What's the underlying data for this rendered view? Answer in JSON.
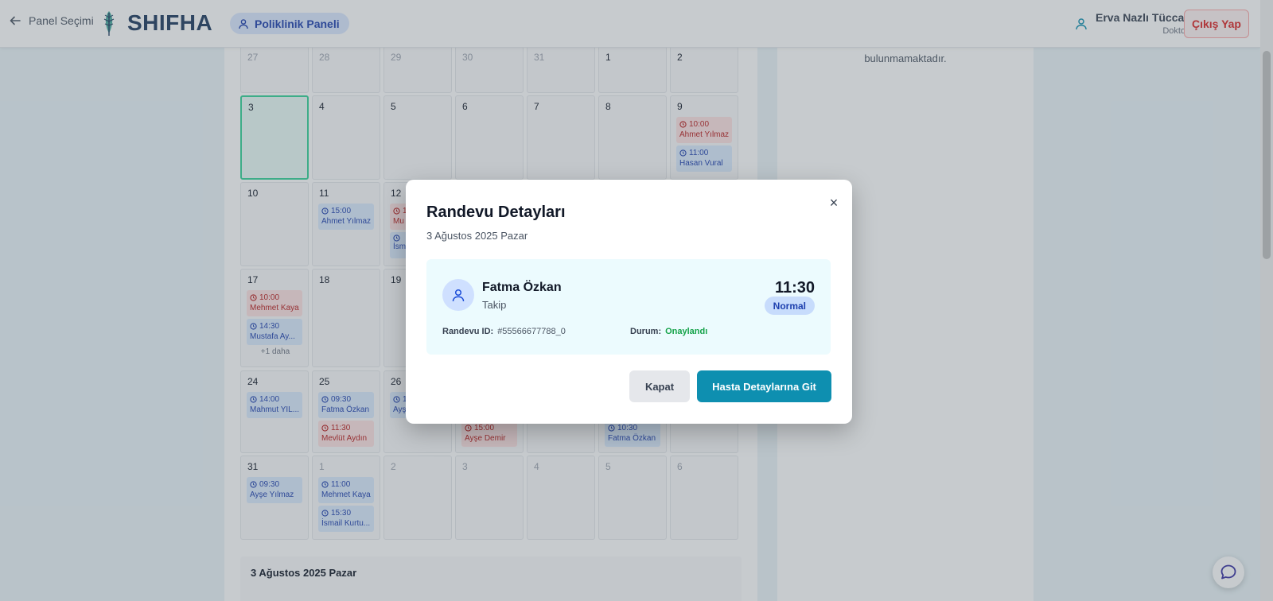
{
  "header": {
    "back_label": "Panel Seçimi",
    "logo_text": "SHIFHA",
    "panel_label": "Poliklinik Paneli",
    "user_name": "Erva Nazlı Tüccar",
    "user_role": "Doktor",
    "logout_label": "Çıkış Yap"
  },
  "side_panel": {
    "message_partial": "bulunmamaktadır."
  },
  "calendar": {
    "weeks": [
      {
        "days": [
          {
            "num": "27",
            "muted": true,
            "appts": []
          },
          {
            "num": "28",
            "muted": true,
            "appts": []
          },
          {
            "num": "29",
            "muted": true,
            "appts": []
          },
          {
            "num": "30",
            "muted": true,
            "appts": []
          },
          {
            "num": "31",
            "muted": true,
            "appts": []
          },
          {
            "num": "1",
            "muted": false,
            "appts": []
          },
          {
            "num": "2",
            "muted": false,
            "appts": []
          }
        ]
      },
      {
        "days": [
          {
            "num": "3",
            "today": true,
            "appts": []
          },
          {
            "num": "4",
            "appts": []
          },
          {
            "num": "5",
            "appts": []
          },
          {
            "num": "6",
            "appts": []
          },
          {
            "num": "7",
            "appts": []
          },
          {
            "num": "8",
            "appts": []
          },
          {
            "num": "9",
            "appts": [
              {
                "time": "10:00",
                "name": "Ahmet Yılmaz",
                "color": "red"
              },
              {
                "time": "11:00",
                "name": "Hasan Vural",
                "color": "blue"
              }
            ]
          }
        ]
      },
      {
        "days": [
          {
            "num": "10",
            "appts": []
          },
          {
            "num": "11",
            "appts": [
              {
                "time": "15:00",
                "name": "Ahmet Yılmaz",
                "color": "blue"
              }
            ]
          },
          {
            "num": "12",
            "appts": [
              {
                "time": "1",
                "name": "Mu",
                "color": "red"
              },
              {
                "time": "",
                "name": "İsm",
                "color": "blue"
              }
            ]
          },
          {
            "num": "",
            "appts": []
          },
          {
            "num": "",
            "appts": []
          },
          {
            "num": "",
            "appts": []
          },
          {
            "num": "",
            "appts": []
          }
        ]
      },
      {
        "days": [
          {
            "num": "17",
            "appts": [
              {
                "time": "10:00",
                "name": "Mehmet Kaya",
                "color": "red"
              },
              {
                "time": "14:30",
                "name": "Mustafa Ay...",
                "color": "blue"
              }
            ],
            "more": "+1 daha"
          },
          {
            "num": "18",
            "appts": []
          },
          {
            "num": "19",
            "appts": []
          },
          {
            "num": "",
            "appts": []
          },
          {
            "num": "",
            "appts": []
          },
          {
            "num": "",
            "appts": []
          },
          {
            "num": "",
            "appts": []
          }
        ]
      },
      {
        "days": [
          {
            "num": "24",
            "appts": [
              {
                "time": "14:00",
                "name": "Mahmut YIL...",
                "color": "blue"
              }
            ]
          },
          {
            "num": "25",
            "appts": [
              {
                "time": "09:30",
                "name": "Fatma Özkan",
                "color": "blue"
              },
              {
                "time": "11:30",
                "name": "Mevlüt Aydın",
                "color": "red"
              }
            ]
          },
          {
            "num": "26",
            "appts": [
              {
                "time": "1",
                "name": "Ayş",
                "color": "blue"
              }
            ]
          },
          {
            "num": "",
            "appts": [
              {
                "time": "",
                "name": "",
                "color": "blue"
              },
              {
                "time": "15:00",
                "name": "Ayşe Demir",
                "color": "red"
              }
            ]
          },
          {
            "num": "",
            "appts": []
          },
          {
            "num": "",
            "appts": [
              {
                "time": "",
                "name": "",
                "color": "blue"
              },
              {
                "time": "10:30",
                "name": "Fatma Özkan",
                "color": "blue"
              }
            ]
          },
          {
            "num": "",
            "appts": []
          }
        ]
      },
      {
        "days": [
          {
            "num": "31",
            "appts": [
              {
                "time": "09:30",
                "name": "Ayşe Yılmaz",
                "color": "blue"
              }
            ]
          },
          {
            "num": "1",
            "muted": true,
            "appts": [
              {
                "time": "11:00",
                "name": "Mehmet Kaya",
                "color": "blue"
              },
              {
                "time": "15:30",
                "name": "İsmail Kurtu...",
                "color": "blue"
              }
            ]
          },
          {
            "num": "2",
            "muted": true,
            "appts": []
          },
          {
            "num": "3",
            "muted": true,
            "appts": []
          },
          {
            "num": "4",
            "muted": true,
            "appts": []
          },
          {
            "num": "5",
            "muted": true,
            "appts": []
          },
          {
            "num": "6",
            "muted": true,
            "appts": []
          }
        ]
      }
    ],
    "selected_day_title": "3 Ağustos 2025 Pazar"
  },
  "modal": {
    "title": "Randevu Detayları",
    "subtitle": "3 Ağustos 2025 Pazar",
    "close_symbol": "×",
    "patient_name": "Fatma Özkan",
    "appointment_type": "Takip",
    "time": "11:30",
    "priority": "Normal",
    "id_label": "Randevu ID:",
    "id_value": "#55566677788_0",
    "status_label": "Durum:",
    "status_value": "Onaylandı",
    "close_button": "Kapat",
    "go_button": "Hasta Detaylarına Git"
  },
  "colors": {
    "primary": "#0e8fb0",
    "status_ok": "#16a34a",
    "logout": "#dc2626"
  }
}
